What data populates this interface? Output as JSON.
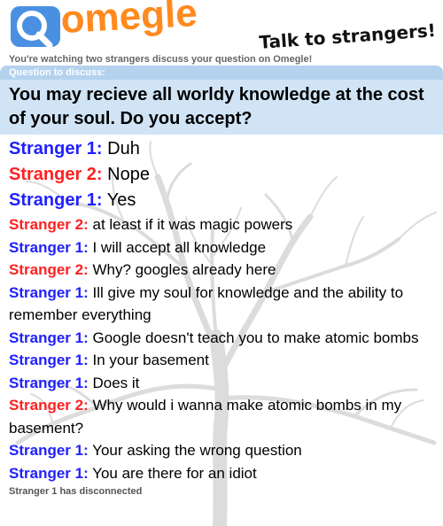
{
  "header": {
    "logo_text": "omegle",
    "tagline": "Talk to strangers!"
  },
  "watching_text": "You're watching two strangers discuss your question on Omegle!",
  "question": {
    "label": "Question to discuss:",
    "text": "You may recieve all worldy knowledge at the cost of your soul. Do you accept?"
  },
  "messages": [
    {
      "speaker": "Stranger 1:",
      "text": "Duh"
    },
    {
      "speaker": "Stranger 2:",
      "text": "Nope"
    },
    {
      "speaker": "Stranger 1:",
      "text": "Yes"
    },
    {
      "speaker": "Stranger 2:",
      "text": "at least if it was magic powers"
    },
    {
      "speaker": "Stranger 1:",
      "text": "I will accept all knowledge"
    },
    {
      "speaker": "Stranger 2:",
      "text": "Why? googles already here"
    },
    {
      "speaker": "Stranger 1:",
      "text": "Ill give my soul for knowledge and the ability to remember everything"
    },
    {
      "speaker": "Stranger 1:",
      "text": "Google doesn't teach you to make atomic bombs"
    },
    {
      "speaker": "Stranger 1:",
      "text": "In your basement"
    },
    {
      "speaker": "Stranger 1:",
      "text": "Does it"
    },
    {
      "speaker": "Stranger 2:",
      "text": "Why would i wanna make atomic bombs in my basement?"
    },
    {
      "speaker": "Stranger 1:",
      "text": "Your asking the wrong question"
    },
    {
      "speaker": "Stranger 1:",
      "text": "You are there for an idiot"
    }
  ],
  "status": "Stranger 1 has disconnected",
  "colors": {
    "stranger1": "#2020ff",
    "stranger2": "#ff2020",
    "logo": "#ff8a1e",
    "question_bg": "#d0e4f6",
    "question_label_bg": "#b4d2ee"
  },
  "icons": {
    "logo": "omegle-logo-icon",
    "background": "tree-watermark"
  }
}
